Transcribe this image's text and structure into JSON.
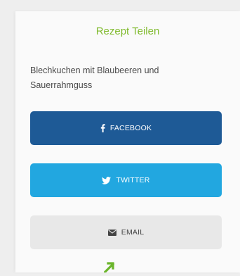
{
  "share_panel": {
    "title": "Rezept Teilen",
    "recipe_name": "Blechkuchen mit Blaubeeren und Sauerrahmguss",
    "buttons": {
      "facebook": {
        "label": "FACEBOOK",
        "icon": "facebook-icon",
        "color": "#1e5a96"
      },
      "twitter": {
        "label": "TWITTER",
        "icon": "twitter-icon",
        "color": "#22a7e0"
      },
      "email": {
        "label": "EMAIL",
        "icon": "envelope-icon",
        "color": "#e8e8e8"
      }
    }
  },
  "colors": {
    "title_accent": "#7fba2c",
    "cursor_green": "#6bb52b"
  },
  "cursor": {
    "icon": "arrow-cursor-icon"
  }
}
